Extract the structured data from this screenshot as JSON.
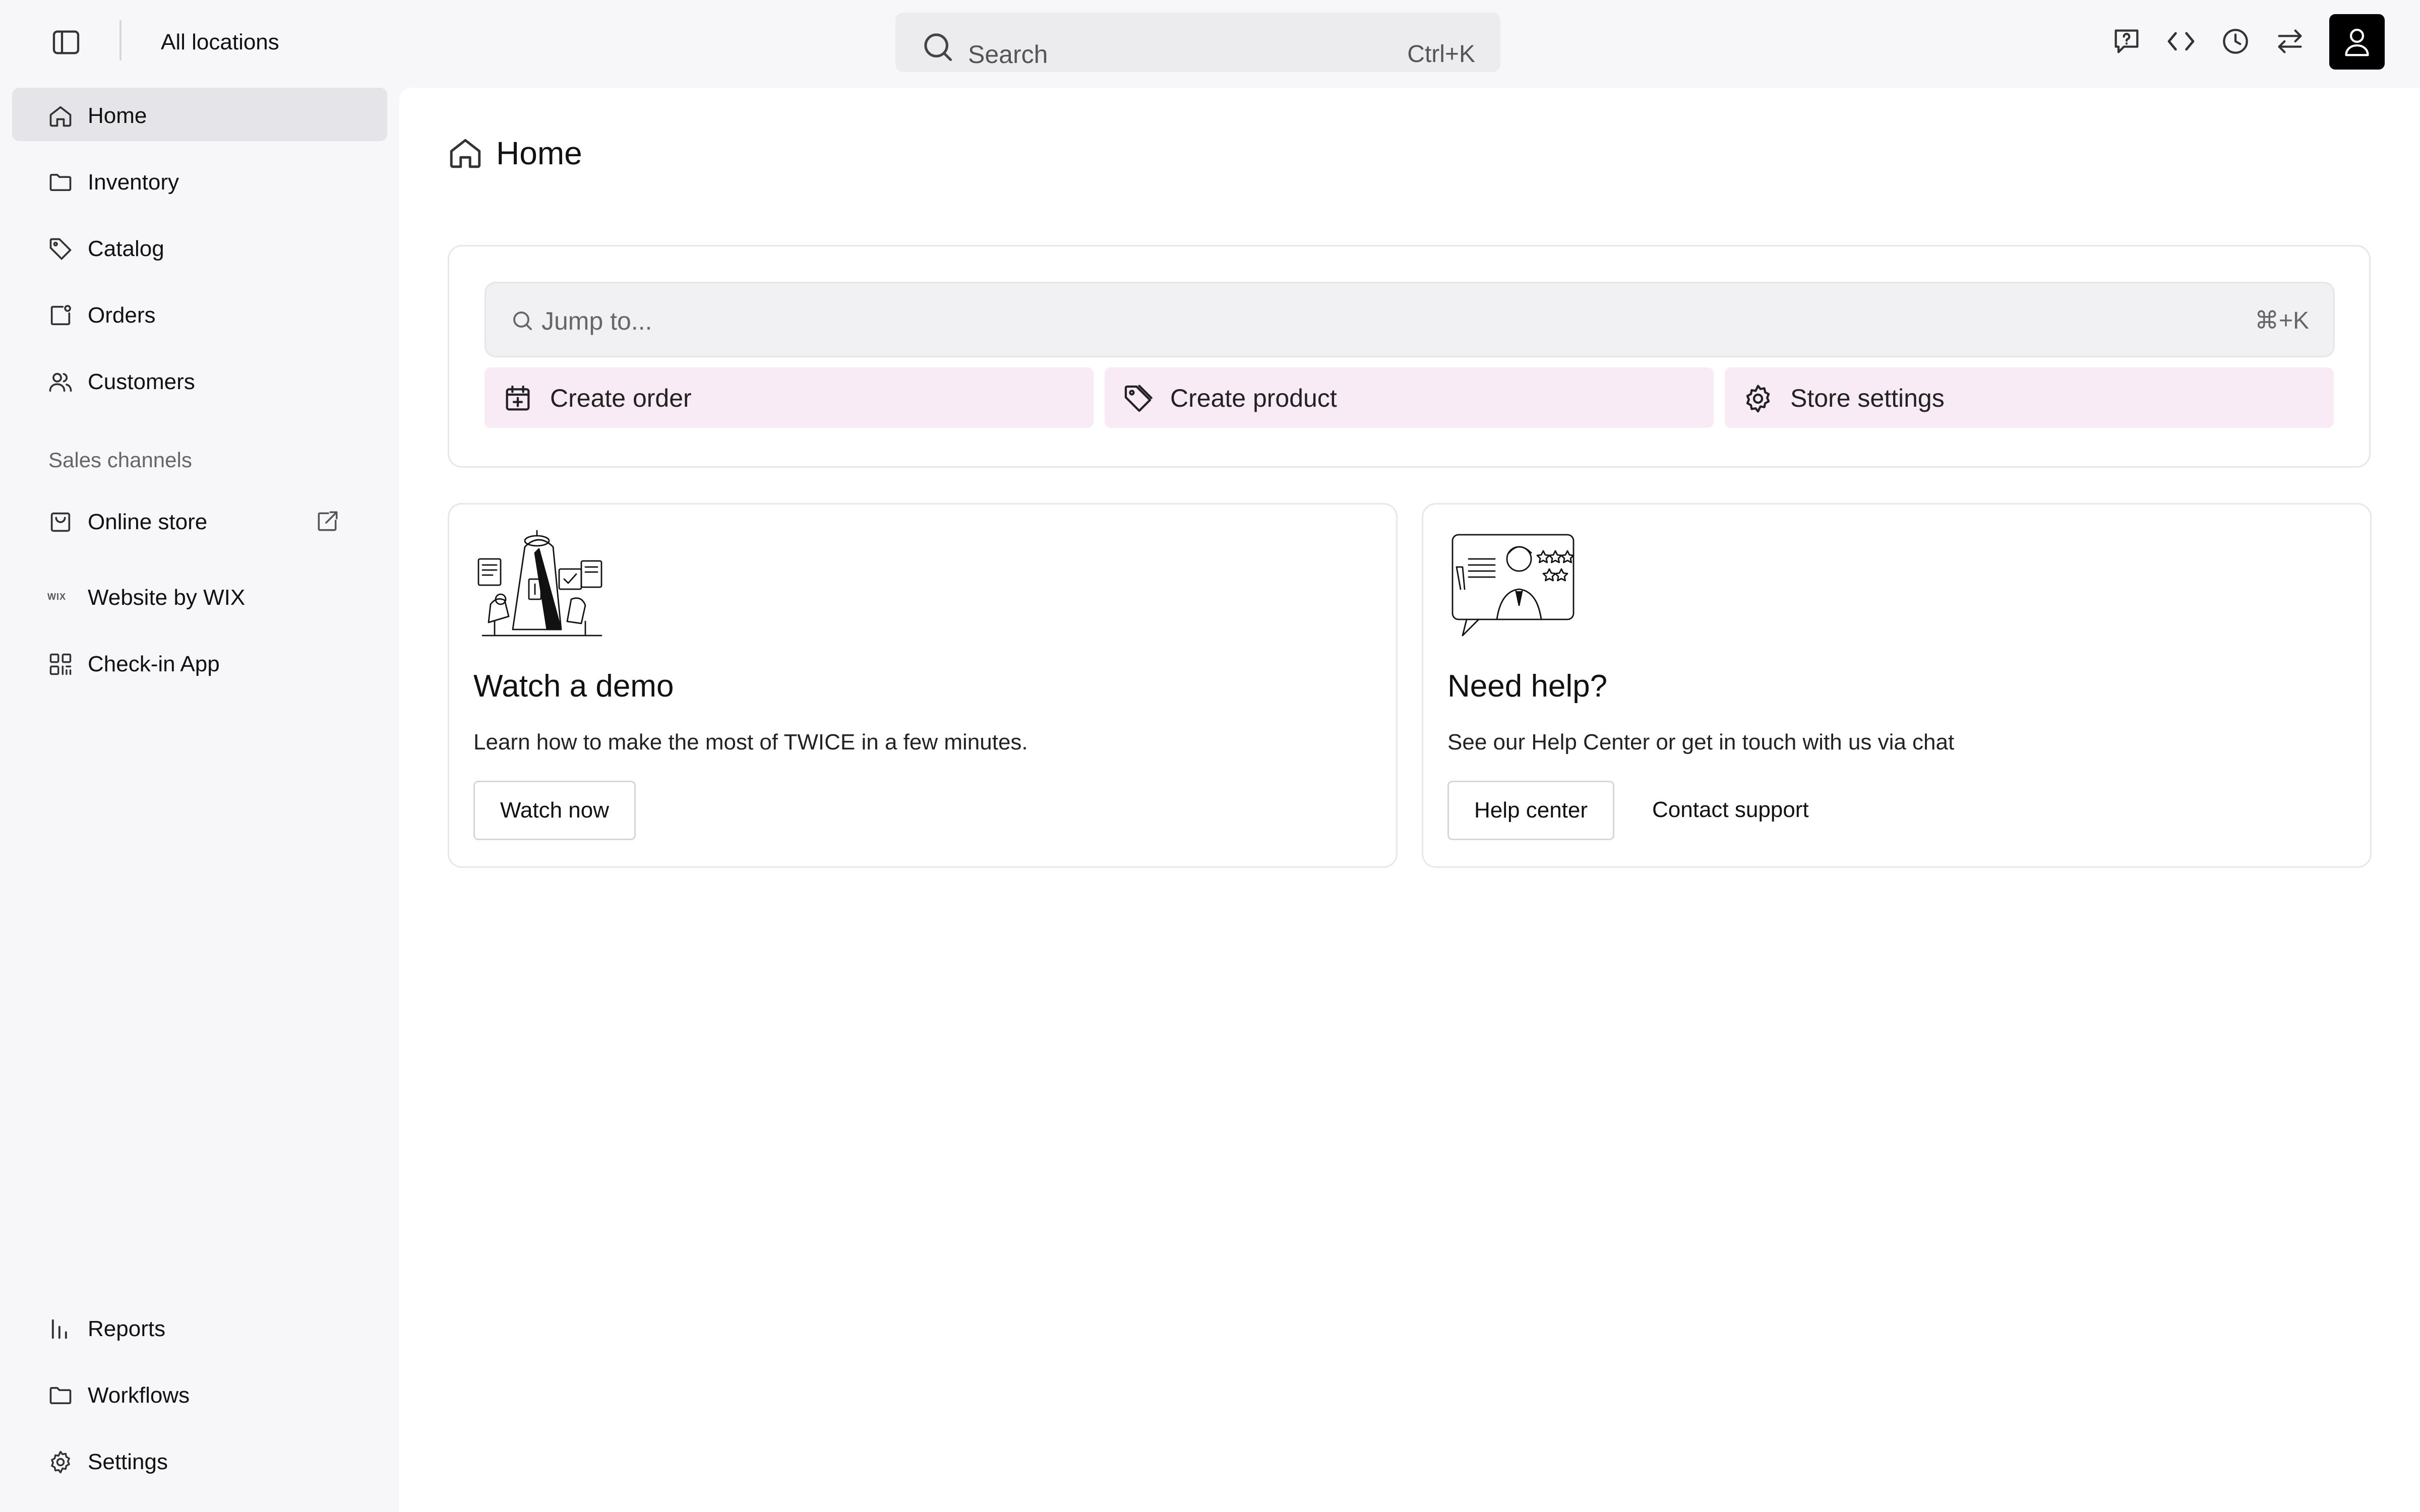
{
  "topbar": {
    "location": "All locations",
    "search_placeholder": "Search",
    "search_shortcut": "Ctrl+K",
    "icons": [
      "help-icon",
      "code-icon",
      "clock-icon",
      "switch-icon",
      "user-icon"
    ]
  },
  "sidebar": {
    "primary": [
      {
        "label": "Home",
        "icon": "home-icon",
        "active": true
      },
      {
        "label": "Inventory",
        "icon": "folder-icon"
      },
      {
        "label": "Catalog",
        "icon": "tag-icon"
      },
      {
        "label": "Orders",
        "icon": "orders-icon"
      },
      {
        "label": "Customers",
        "icon": "users-icon"
      }
    ],
    "section_label": "Sales channels",
    "channels": [
      {
        "label": "Online store",
        "icon": "store-icon",
        "external": true
      },
      {
        "label": "Website by WIX",
        "icon": "wix-icon"
      },
      {
        "label": "Check-in App",
        "icon": "qr-icon"
      }
    ],
    "bottom": [
      {
        "label": "Reports",
        "icon": "chart-icon"
      },
      {
        "label": "Workflows",
        "icon": "folder-icon"
      },
      {
        "label": "Settings",
        "icon": "gear-icon"
      }
    ],
    "wix_mark": "WIX"
  },
  "main": {
    "title": "Home",
    "jump": {
      "placeholder": "Jump to...",
      "shortcut": "⌘+K"
    },
    "quick_actions": [
      {
        "label": "Create order",
        "icon": "calendar-plus-icon"
      },
      {
        "label": "Create product",
        "icon": "tag-icon"
      },
      {
        "label": "Store settings",
        "icon": "gear-icon"
      }
    ],
    "demo": {
      "title": "Watch a demo",
      "desc": "Learn how to make the most of TWICE in a few minutes.",
      "button": "Watch now"
    },
    "help": {
      "title": "Need help?",
      "desc": "See our Help Center or get in touch with us via chat",
      "button": "Help center",
      "link": "Contact support"
    }
  },
  "colors": {
    "background": "#f7f7f9",
    "panel": "#ffffff",
    "active_nav": "#e5e5e9",
    "quick_action": "#f9ebf5",
    "avatar": "#000000"
  }
}
